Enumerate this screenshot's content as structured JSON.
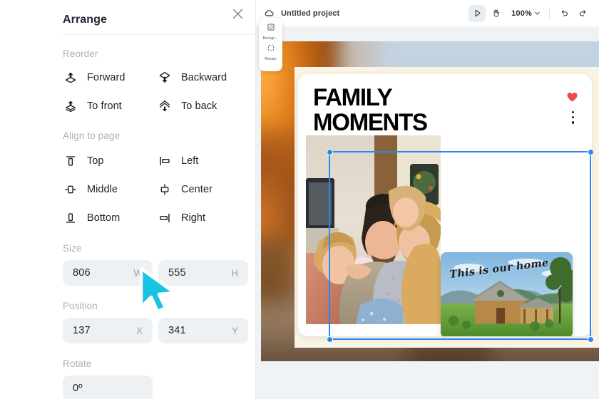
{
  "panel": {
    "title": "Arrange",
    "close_icon": "close-icon",
    "sections": {
      "reorder": {
        "label": "Reorder",
        "items": [
          {
            "label": "Forward",
            "icon": "bring-forward-icon"
          },
          {
            "label": "Backward",
            "icon": "send-backward-icon"
          },
          {
            "label": "To front",
            "icon": "bring-to-front-icon"
          },
          {
            "label": "To back",
            "icon": "send-to-back-icon"
          }
        ]
      },
      "align": {
        "label": "Align to page",
        "items": [
          {
            "label": "Top",
            "icon": "align-top-icon"
          },
          {
            "label": "Left",
            "icon": "align-left-icon"
          },
          {
            "label": "Middle",
            "icon": "align-middle-icon"
          },
          {
            "label": "Center",
            "icon": "align-center-icon"
          },
          {
            "label": "Bottom",
            "icon": "align-bottom-icon"
          },
          {
            "label": "Right",
            "icon": "align-right-icon"
          }
        ]
      },
      "size": {
        "label": "Size",
        "width": {
          "value": "806",
          "unit": "W"
        },
        "height": {
          "value": "555",
          "unit": "H"
        }
      },
      "position": {
        "label": "Position",
        "x": {
          "value": "137",
          "unit": "X"
        },
        "y": {
          "value": "341",
          "unit": "Y"
        }
      },
      "rotate": {
        "label": "Rotate",
        "angle": {
          "value": "0º",
          "unit": ""
        }
      }
    }
  },
  "editor": {
    "topbar": {
      "cloud_icon": "cloud-icon",
      "project_name": "Untitled project",
      "select_tool_icon": "cursor-tool-icon",
      "hand_tool_icon": "hand-tool-icon",
      "zoom_value": "100%",
      "zoom_caret_icon": "chevron-down-icon",
      "undo_icon": "undo-icon",
      "redo_icon": "redo-icon"
    },
    "minibar": {
      "items": [
        {
          "label": "Backgr…",
          "icon": "background-icon"
        },
        {
          "label": "Resize",
          "icon": "resize-icon"
        }
      ]
    },
    "design": {
      "card_title_line1": "FAMILY",
      "card_title_line2": "MOMENTS",
      "heart_icon": "heart-icon",
      "menu_icon": "kebab-menu-icon",
      "photo_main_alt": "family-photo",
      "photo_home_alt": "home-photo",
      "home_caption": "This is our home"
    },
    "selection": {
      "handle_icon": "resize-handle"
    },
    "cursor_icon": "mouse-pointer"
  },
  "colors": {
    "accent_blue": "#2b87f0",
    "heart_red": "#ef4a50",
    "field_bg": "#eef1f3",
    "canvas_bg": "#f0f3f6",
    "cream": "#fbf4e4",
    "cursor_cyan": "#17c4e3"
  }
}
